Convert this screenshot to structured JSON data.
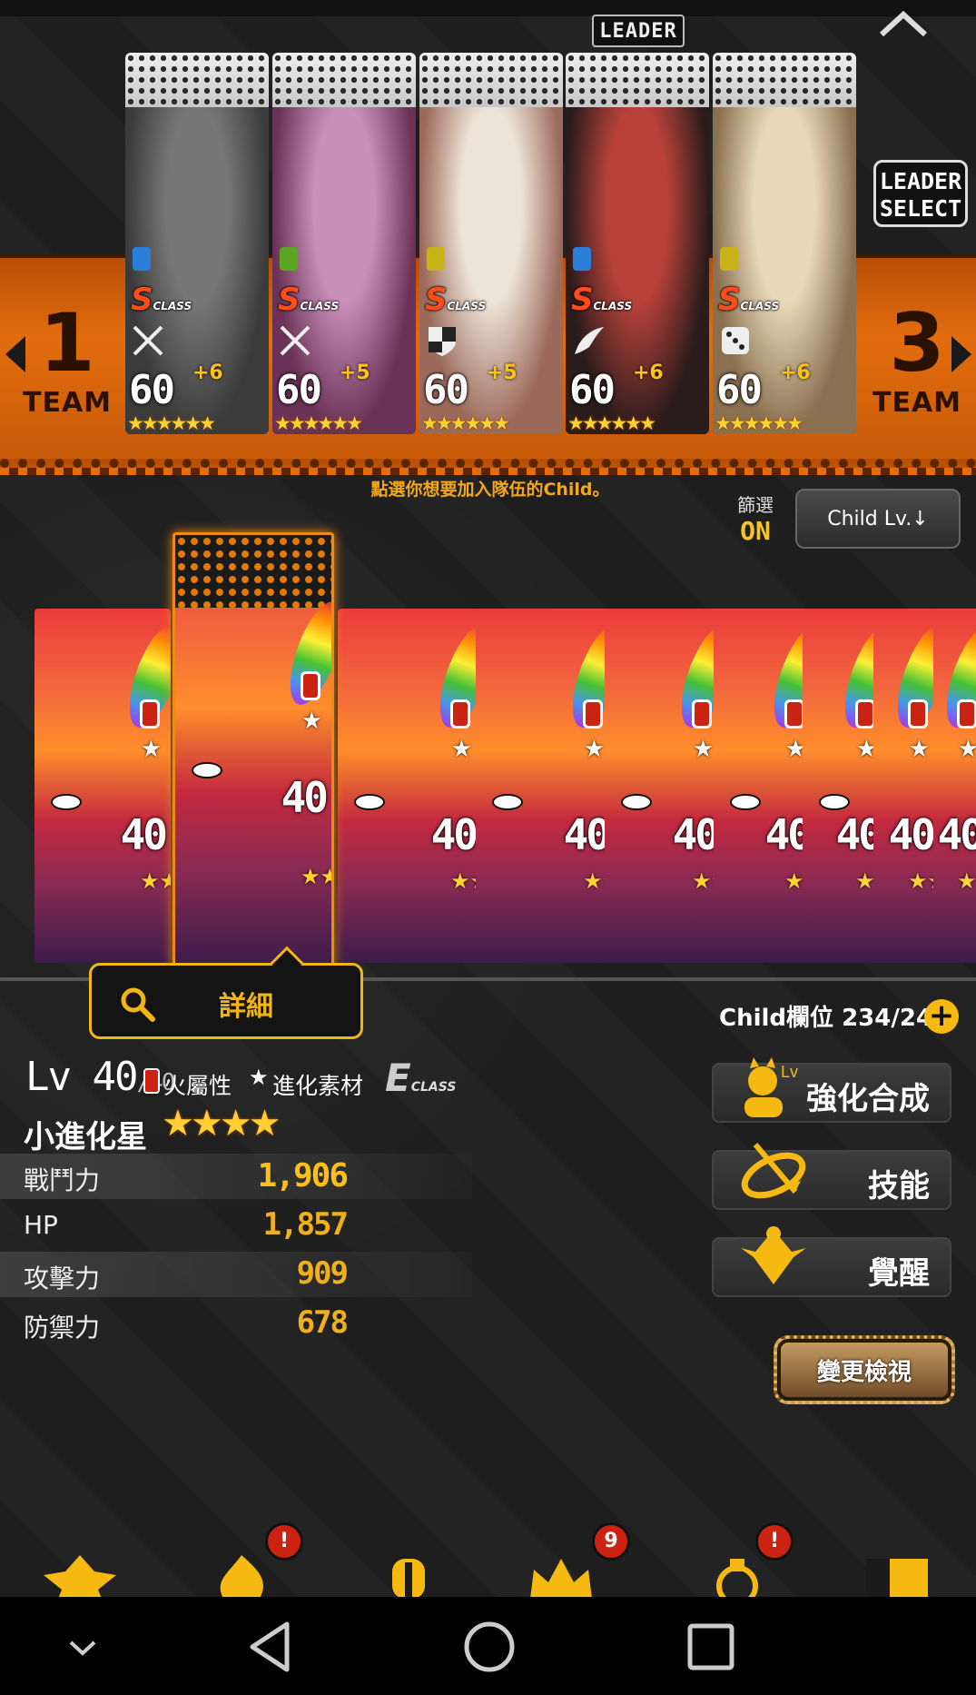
{
  "header": {
    "leader_tag": "LEADER",
    "leader_select": [
      "LEADER",
      "SELECT"
    ]
  },
  "team": {
    "left": {
      "number": "1",
      "word": "TEAM"
    },
    "right": {
      "number": "3",
      "word": "TEAM"
    },
    "members": [
      {
        "level": "60",
        "plus": "+6",
        "class": "S",
        "class_sub": "CLASS",
        "stars": "★★★★★★",
        "element_color": "#2a7fd8",
        "role_icon": "swords-icon"
      },
      {
        "level": "60",
        "plus": "+5",
        "class": "S",
        "class_sub": "CLASS",
        "stars": "★★★★★★",
        "element_color": "#5aa521",
        "role_icon": "swords-icon"
      },
      {
        "level": "60",
        "plus": "+5",
        "class": "S",
        "class_sub": "CLASS",
        "stars": "★★★★★★",
        "element_color": "#c9b21a",
        "role_icon": "shield-icon"
      },
      {
        "level": "60",
        "plus": "+6",
        "class": "S",
        "class_sub": "CLASS",
        "stars": "★★★★★★",
        "element_color": "#2a7fd8",
        "role_icon": "wing-icon"
      },
      {
        "level": "60",
        "plus": "+6",
        "class": "S",
        "class_sub": "CLASS",
        "stars": "★★★★★★",
        "element_color": "#c9b21a",
        "role_icon": "dice-icon"
      }
    ]
  },
  "instruction": "點選你想要加入隊伍的Child。",
  "filter": {
    "label": "篩選",
    "state": "ON"
  },
  "sort_button": "Child Lv.↓",
  "children": {
    "selected": {
      "level": "40",
      "stars": "★★★★"
    },
    "others": [
      {
        "level": "40",
        "stars": "★★★★"
      },
      {
        "level": "40",
        "stars": "★★★★"
      },
      {
        "level": "40",
        "stars": "★★★★"
      },
      {
        "level": "40",
        "stars": "★★★★"
      },
      {
        "level": "40",
        "stars": "★★★★"
      },
      {
        "level": "40",
        "stars": "★★★★"
      },
      {
        "level": "40",
        "stars": "★★★★"
      },
      {
        "level": "40",
        "stars": "★★★★"
      }
    ]
  },
  "detail_button": "詳細",
  "child_slot": "Child欄位 234/240",
  "selected_child": {
    "level": "Lv 40",
    "level_max": "/40",
    "attribute": "火屬性",
    "type": "進化素材",
    "class": "E",
    "class_sub": "CLASS",
    "name": "小進化星",
    "rarity": "★★★★"
  },
  "stats": [
    {
      "label": "戰鬥力",
      "value": "1,906"
    },
    {
      "label": "HP",
      "value": "1,857"
    },
    {
      "label": "攻擊力",
      "value": "909"
    },
    {
      "label": "防禦力",
      "value": "678"
    }
  ],
  "side_buttons": {
    "enhance": "強化合成",
    "enhance_lv": "Lv",
    "skill": "技能",
    "awaken": "覺醒",
    "change_view": "變更檢視"
  },
  "nav_badges": [
    "!",
    "9",
    "!"
  ],
  "colors": {
    "accent": "#f1b616",
    "team_band": "#e26d0e",
    "badge": "#cc2211"
  }
}
